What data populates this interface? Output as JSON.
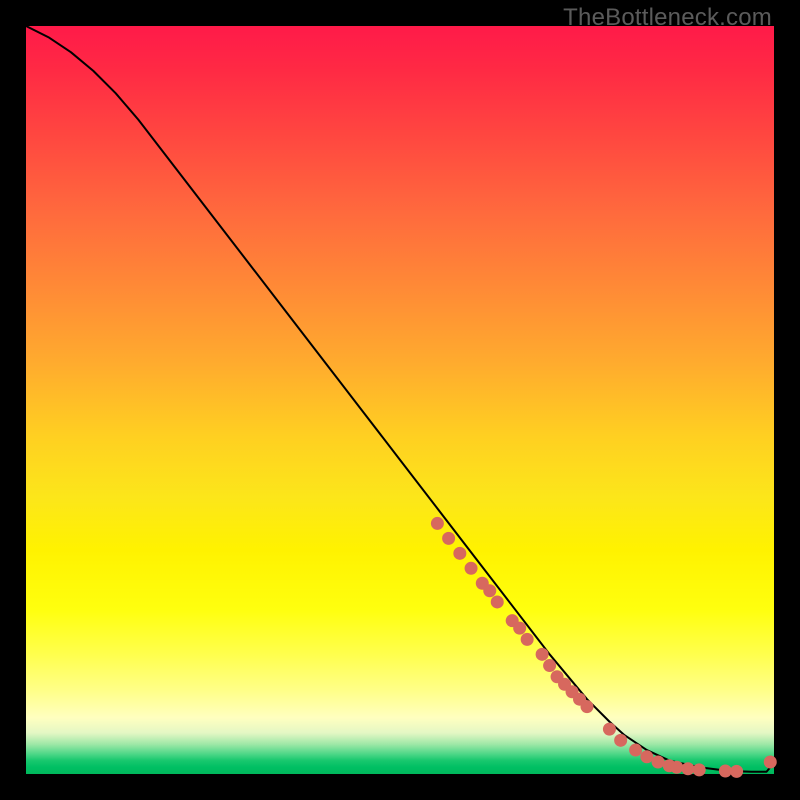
{
  "watermark": "TheBottleneck.com",
  "chart_data": {
    "type": "line",
    "title": "",
    "xlabel": "",
    "ylabel": "",
    "xlim": [
      0,
      100
    ],
    "ylim": [
      0,
      100
    ],
    "grid": false,
    "legend": false,
    "series": [
      {
        "name": "curve",
        "style": "line",
        "color": "#000000",
        "x": [
          0,
          3,
          6,
          9,
          12,
          15,
          20,
          25,
          30,
          35,
          40,
          45,
          50,
          55,
          60,
          65,
          70,
          75,
          78,
          80,
          83,
          86,
          90,
          94,
          97,
          99,
          100
        ],
        "y": [
          100,
          98.5,
          96.5,
          94,
          91,
          87.5,
          81,
          74.5,
          68,
          61.5,
          55,
          48.5,
          42,
          35.5,
          29,
          22.5,
          16,
          10,
          7,
          5.2,
          3.2,
          1.8,
          0.9,
          0.4,
          0.3,
          0.3,
          1.5
        ]
      },
      {
        "name": "dots",
        "style": "scatter",
        "color": "#d7685e",
        "x": [
          55,
          56.5,
          58,
          59.5,
          61,
          62,
          63,
          65,
          66,
          67,
          69,
          70,
          71,
          72,
          73,
          74,
          75,
          78,
          79.5,
          81.5,
          83,
          84.5,
          86,
          87,
          88.5,
          90,
          93.5,
          95,
          99.5
        ],
        "y": [
          33.5,
          31.5,
          29.5,
          27.5,
          25.5,
          24.5,
          23,
          20.5,
          19.5,
          18,
          16,
          14.5,
          13,
          12,
          11,
          10,
          9,
          6,
          4.5,
          3.2,
          2.3,
          1.6,
          1.1,
          0.9,
          0.7,
          0.55,
          0.4,
          0.35,
          1.6
        ]
      }
    ]
  }
}
